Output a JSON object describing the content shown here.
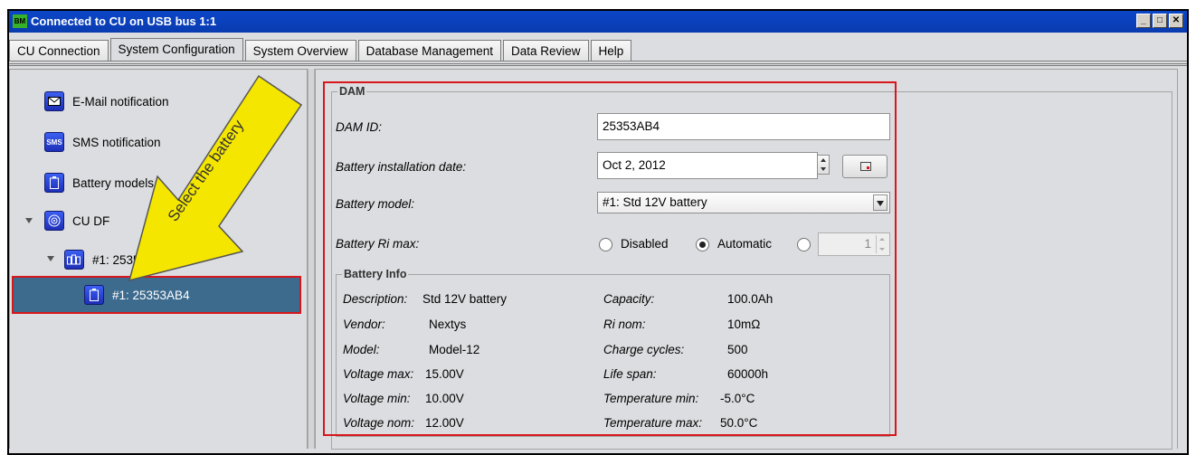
{
  "window": {
    "icon_text": "BM",
    "title": "Connected to CU on USB bus 1:1",
    "minimize": "_",
    "maximize": "□",
    "close": "✕"
  },
  "tabs": [
    {
      "label": "CU Connection",
      "active": false
    },
    {
      "label": "System Configuration",
      "active": true
    },
    {
      "label": "System Overview",
      "active": false
    },
    {
      "label": "Database Management",
      "active": false
    },
    {
      "label": "Data Review",
      "active": false
    },
    {
      "label": "Help",
      "active": false
    }
  ],
  "tree": {
    "email": {
      "label": "E-Mail notification",
      "icon": "envelope-icon"
    },
    "sms": {
      "label": "SMS notification",
      "icon": "sms-icon",
      "icon_text": "SMS"
    },
    "battery_models": {
      "label": "Battery models",
      "icon": "battery-icon"
    },
    "cu": {
      "label": "CU DF",
      "icon": "target-icon"
    },
    "dam_group": {
      "label": "#1: 25353AB4",
      "icon": "dam-icon"
    },
    "selected_battery": {
      "label": "#1: 25353AB4",
      "icon": "battery-icon"
    }
  },
  "callout": {
    "text": "Select the battery",
    "color": "#f5e600"
  },
  "dam": {
    "legend": "DAM",
    "id_label": "DAM ID:",
    "id_value": "25353AB4",
    "install_label": "Battery installation date:",
    "install_value": "Oct 2, 2012",
    "model_label": "Battery model:",
    "model_value": "#1: Std 12V battery",
    "ri_label": "Battery Ri max:",
    "ri_options": {
      "disabled": "Disabled",
      "automatic": "Automatic"
    },
    "ri_selected": "automatic",
    "ri_value": "1"
  },
  "battery_info": {
    "legend": "Battery Info",
    "left": [
      {
        "label": "Description:",
        "value": "Std 12V battery"
      },
      {
        "label": "Vendor:",
        "value": "Nextys"
      },
      {
        "label": "Model:",
        "value": "Model-12"
      },
      {
        "label": "Voltage max:",
        "value": "15.00V"
      },
      {
        "label": "Voltage min:",
        "value": "10.00V"
      },
      {
        "label": "Voltage nom:",
        "value": "12.00V"
      }
    ],
    "right": [
      {
        "label": "Capacity:",
        "value": "100.0Ah"
      },
      {
        "label": "Ri nom:",
        "value": "10mΩ"
      },
      {
        "label": "Charge cycles:",
        "value": "500"
      },
      {
        "label": "Life span:",
        "value": "60000h"
      },
      {
        "label": "Temperature min:",
        "value": "-5.0°C"
      },
      {
        "label": "Temperature max:",
        "value": "50.0°C"
      }
    ]
  },
  "colors": {
    "highlight": "#d8161c",
    "selection": "#3d6b8e",
    "title_bar": "#0b46c8"
  }
}
